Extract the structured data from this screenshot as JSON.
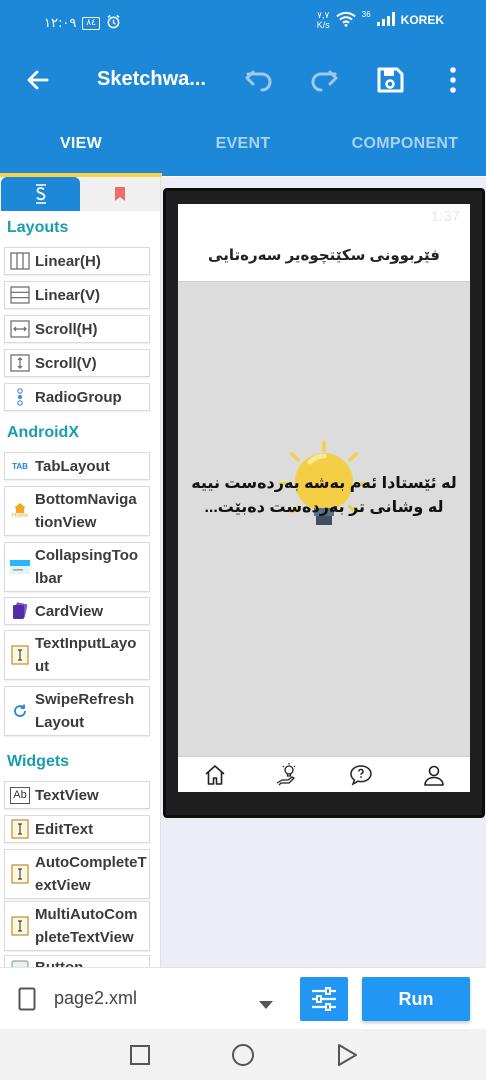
{
  "status_bar": {
    "time": "١٢:٠٩",
    "battery": "٨٤",
    "net_speed_value": "٧,٧",
    "net_speed_unit": "K/s",
    "signal_type": "36",
    "carrier": "KOREK"
  },
  "app_bar": {
    "title": "Sketchwa...",
    "icons": [
      "back-arrow-icon",
      "undo-icon",
      "redo-icon",
      "save-icon",
      "more-vert-icon"
    ]
  },
  "tabs": [
    {
      "label": "VIEW",
      "active": true
    },
    {
      "label": "EVENT",
      "active": false
    },
    {
      "label": "COMPONENT",
      "active": false
    }
  ],
  "palette": {
    "sections": {
      "layouts": "Layouts",
      "androidx": "AndroidX",
      "widgets": "Widgets"
    },
    "items": {
      "linear_h": "Linear(H)",
      "linear_v": "Linear(V)",
      "scroll_h": "Scroll(H)",
      "scroll_v": "Scroll(V)",
      "radio_group": "RadioGroup",
      "tab_layout": "TabLayout",
      "bottom_nav_1": "BottomNaviga",
      "bottom_nav_2": "tionView",
      "collapsing_1": "CollapsingToo",
      "collapsing_2": "lbar",
      "card_view": "CardView",
      "text_input_1": "TextInputLayo",
      "text_input_2": "ut",
      "swipe_1": "SwipeRefresh",
      "swipe_2": "Layout",
      "text_view": "TextView",
      "edit_text": "EditText",
      "auto_complete_1": "AutoCompleteT",
      "auto_complete_2": "extView",
      "multi_auto_1": "MultiAutoCom",
      "multi_auto_2": "pleteTextView",
      "button": "Button"
    },
    "icon_labels": {
      "tab": "TAB",
      "home": "Home",
      "ab": "Ab"
    }
  },
  "preview": {
    "clock": "1:37",
    "toolbar_title": "فێربوونی سکێتچوەیر سەرەتایی",
    "message_line1": "لە ئێستادا ئەم بەشە بەردەست نییە",
    "message_line2": "لە وشانی تر بەردەست دەبێت...",
    "nav_icons": [
      "home-icon",
      "idea-hand-icon",
      "help-bubble-icon",
      "person-icon"
    ]
  },
  "bottom_bar": {
    "file_name": "page2.xml",
    "run_label": "Run"
  },
  "colors": {
    "primary": "#1e88d8",
    "accent": "#f8d347",
    "section_text": "#1a9db0",
    "button_blue": "#2196f3",
    "bulb_yellow": "#f4cf45"
  }
}
